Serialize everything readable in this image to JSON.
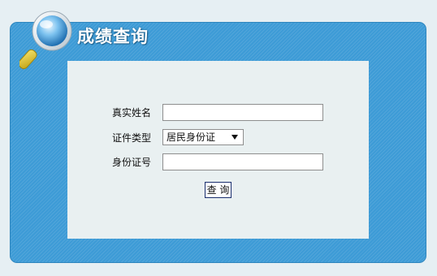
{
  "header": {
    "title": "成绩查询"
  },
  "icons": {
    "logo": "magnifier-icon"
  },
  "colors": {
    "panel": "#3d9bd6",
    "content_bg": "#e9f0f1",
    "page_bg": "#e6eff3"
  },
  "form": {
    "name_label": "真实姓名",
    "name_value": "",
    "id_type_label": "证件类型",
    "id_type_value": "居民身份证",
    "id_number_label": "身份证号",
    "id_number_value": "",
    "submit_label": "查 询"
  }
}
